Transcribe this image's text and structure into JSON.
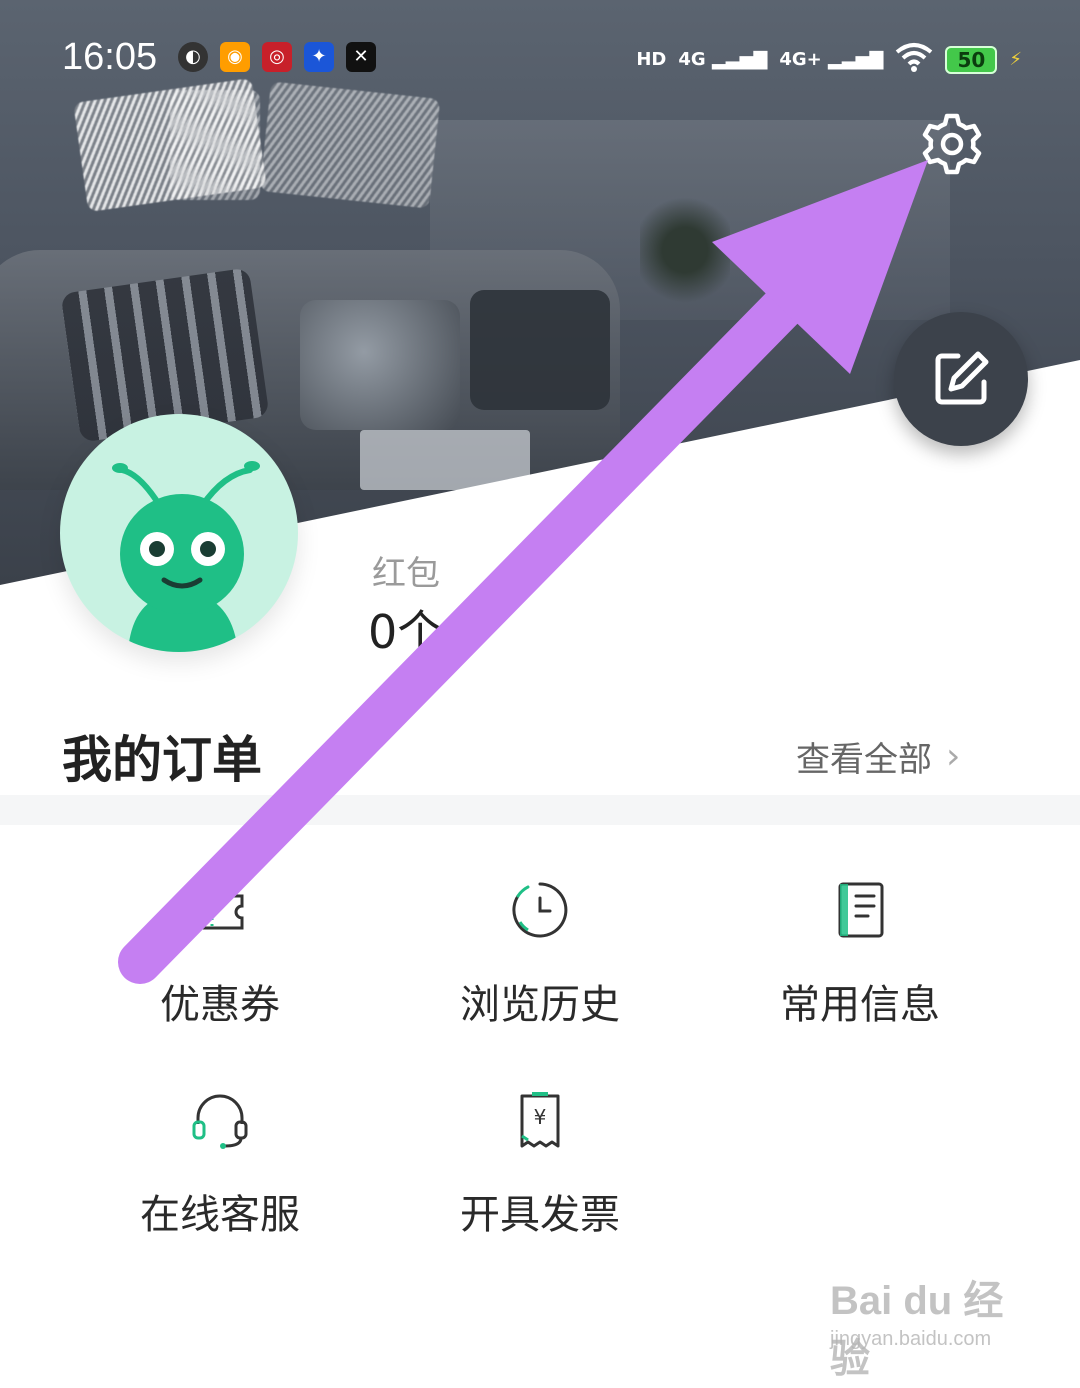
{
  "status_bar": {
    "time": "16:05",
    "app_icons": [
      "browser-icon",
      "weibo-icon",
      "bank-icon",
      "pin-icon",
      "capcut-icon"
    ],
    "hd": "HD",
    "sim1": "4G",
    "sim2": "4G+",
    "battery": "50"
  },
  "profile": {
    "redpack_label": "红包",
    "redpack_value": "0个"
  },
  "orders": {
    "title": "我的订单",
    "view_all": "查看全部"
  },
  "grid": [
    {
      "label": "优惠券",
      "icon": "coupon-icon"
    },
    {
      "label": "浏览历史",
      "icon": "clock-icon"
    },
    {
      "label": "常用信息",
      "icon": "notebook-icon"
    },
    {
      "label": "在线客服",
      "icon": "headset-icon"
    },
    {
      "label": "开具发票",
      "icon": "invoice-icon"
    }
  ],
  "watermark": {
    "brand": "Bai du 经验",
    "url": "jingyan.baidu.com"
  },
  "colors": {
    "accent_green": "#1fbf86",
    "annotation_purple": "#c57ff2"
  }
}
